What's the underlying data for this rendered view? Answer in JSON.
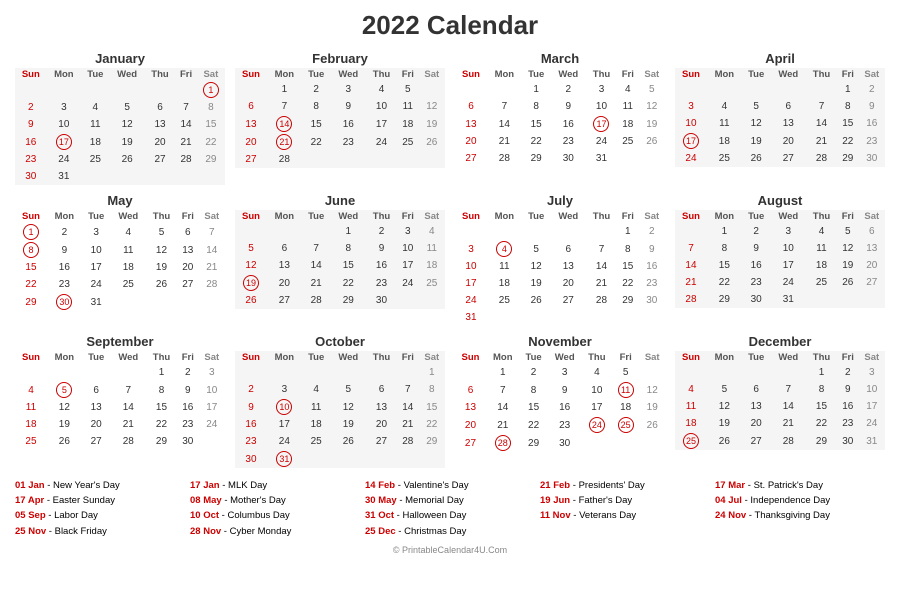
{
  "title": "2022 Calendar",
  "months": [
    {
      "name": "January",
      "days": [
        [
          "",
          "",
          "",
          "",
          "",
          "",
          "1"
        ],
        [
          "2",
          "3",
          "4",
          "5",
          "6",
          "7",
          "8"
        ],
        [
          "9",
          "10",
          "11",
          "12",
          "13",
          "14",
          "15"
        ],
        [
          "16",
          "17",
          "18",
          "19",
          "20",
          "21",
          "22"
        ],
        [
          "23",
          "24",
          "25",
          "26",
          "27",
          "28",
          "29"
        ],
        [
          "30",
          "31",
          "",
          "",
          "",
          "",
          ""
        ]
      ],
      "circles": [
        "1",
        "17"
      ],
      "gray": []
    },
    {
      "name": "February",
      "days": [
        [
          "",
          "1",
          "2",
          "3",
          "4",
          "5",
          ""
        ],
        [
          "6",
          "7",
          "8",
          "9",
          "10",
          "11",
          "12"
        ],
        [
          "13",
          "14",
          "15",
          "16",
          "17",
          "18",
          "19"
        ],
        [
          "20",
          "21",
          "22",
          "23",
          "24",
          "25",
          "26"
        ],
        [
          "27",
          "28",
          "",
          "",
          "",
          "",
          ""
        ]
      ],
      "circles": [
        "14",
        "21"
      ],
      "gray": []
    },
    {
      "name": "March",
      "days": [
        [
          "",
          "",
          "1",
          "2",
          "3",
          "4",
          "5"
        ],
        [
          "6",
          "7",
          "8",
          "9",
          "10",
          "11",
          "12"
        ],
        [
          "13",
          "14",
          "15",
          "16",
          "17",
          "18",
          "19"
        ],
        [
          "20",
          "21",
          "22",
          "23",
          "24",
          "25",
          "26"
        ],
        [
          "27",
          "28",
          "29",
          "30",
          "31",
          "",
          ""
        ]
      ],
      "circles": [
        "17"
      ],
      "gray": []
    },
    {
      "name": "April",
      "days": [
        [
          "",
          "",
          "",
          "",
          "",
          "1",
          "2"
        ],
        [
          "3",
          "4",
          "5",
          "6",
          "7",
          "8",
          "9"
        ],
        [
          "10",
          "11",
          "12",
          "13",
          "14",
          "15",
          "16"
        ],
        [
          "17",
          "18",
          "19",
          "20",
          "21",
          "22",
          "23"
        ],
        [
          "24",
          "25",
          "26",
          "27",
          "28",
          "29",
          "30"
        ]
      ],
      "circles": [
        "17"
      ],
      "gray": []
    },
    {
      "name": "May",
      "days": [
        [
          "1",
          "2",
          "3",
          "4",
          "5",
          "6",
          "7"
        ],
        [
          "8",
          "9",
          "10",
          "11",
          "12",
          "13",
          "14"
        ],
        [
          "15",
          "16",
          "17",
          "18",
          "19",
          "20",
          "21"
        ],
        [
          "22",
          "23",
          "24",
          "25",
          "26",
          "27",
          "28"
        ],
        [
          "29",
          "30",
          "31",
          "",
          "",
          "",
          ""
        ]
      ],
      "circles": [
        "1",
        "8",
        "30"
      ],
      "gray": []
    },
    {
      "name": "June",
      "days": [
        [
          "",
          "",
          "",
          "1",
          "2",
          "3",
          "4"
        ],
        [
          "5",
          "6",
          "7",
          "8",
          "9",
          "10",
          "11"
        ],
        [
          "12",
          "13",
          "14",
          "15",
          "16",
          "17",
          "18"
        ],
        [
          "19",
          "20",
          "21",
          "22",
          "23",
          "24",
          "25"
        ],
        [
          "26",
          "27",
          "28",
          "29",
          "30",
          "",
          ""
        ]
      ],
      "circles": [
        "19"
      ],
      "gray": []
    },
    {
      "name": "July",
      "days": [
        [
          "",
          "",
          "",
          "",
          "",
          "1",
          "2"
        ],
        [
          "3",
          "4",
          "5",
          "6",
          "7",
          "8",
          "9"
        ],
        [
          "10",
          "11",
          "12",
          "13",
          "14",
          "15",
          "16"
        ],
        [
          "17",
          "18",
          "19",
          "20",
          "21",
          "22",
          "23"
        ],
        [
          "24",
          "25",
          "26",
          "27",
          "28",
          "29",
          "30"
        ],
        [
          "31",
          "",
          "",
          "",
          "",
          "",
          ""
        ]
      ],
      "circles": [
        "4"
      ],
      "gray": []
    },
    {
      "name": "August",
      "days": [
        [
          "",
          "1",
          "2",
          "3",
          "4",
          "5",
          "6"
        ],
        [
          "7",
          "8",
          "9",
          "10",
          "11",
          "12",
          "13"
        ],
        [
          "14",
          "15",
          "16",
          "17",
          "18",
          "19",
          "20"
        ],
        [
          "21",
          "22",
          "23",
          "24",
          "25",
          "26",
          "27"
        ],
        [
          "28",
          "29",
          "30",
          "31",
          "",
          "",
          ""
        ]
      ],
      "circles": [],
      "gray": []
    },
    {
      "name": "September",
      "days": [
        [
          "",
          "",
          "",
          "",
          "1",
          "2",
          "3"
        ],
        [
          "4",
          "5",
          "6",
          "7",
          "8",
          "9",
          "10"
        ],
        [
          "11",
          "12",
          "13",
          "14",
          "15",
          "16",
          "17"
        ],
        [
          "18",
          "19",
          "20",
          "21",
          "22",
          "23",
          "24"
        ],
        [
          "25",
          "26",
          "27",
          "28",
          "29",
          "30",
          ""
        ]
      ],
      "circles": [
        "5"
      ],
      "gray": []
    },
    {
      "name": "October",
      "days": [
        [
          "",
          "",
          "",
          "",
          "",
          "",
          "1"
        ],
        [
          "2",
          "3",
          "4",
          "5",
          "6",
          "7",
          "8"
        ],
        [
          "9",
          "10",
          "11",
          "12",
          "13",
          "14",
          "15"
        ],
        [
          "16",
          "17",
          "18",
          "19",
          "20",
          "21",
          "22"
        ],
        [
          "23",
          "24",
          "25",
          "26",
          "27",
          "28",
          "29"
        ],
        [
          "30",
          "31",
          "",
          "",
          "",
          "",
          ""
        ]
      ],
      "circles": [
        "10",
        "31"
      ],
      "gray": []
    },
    {
      "name": "November",
      "days": [
        [
          "",
          "1",
          "2",
          "3",
          "4",
          "5",
          ""
        ],
        [
          "6",
          "7",
          "8",
          "9",
          "10",
          "11",
          "12"
        ],
        [
          "13",
          "14",
          "15",
          "16",
          "17",
          "18",
          "19"
        ],
        [
          "20",
          "21",
          "22",
          "23",
          "24",
          "25",
          "26"
        ],
        [
          "27",
          "28",
          "29",
          "30",
          "",
          "",
          ""
        ]
      ],
      "circles": [
        "11",
        "24",
        "25",
        "28"
      ],
      "gray": []
    },
    {
      "name": "December",
      "days": [
        [
          "",
          "",
          "",
          "",
          "1",
          "2",
          "3"
        ],
        [
          "4",
          "5",
          "6",
          "7",
          "8",
          "9",
          "10"
        ],
        [
          "11",
          "12",
          "13",
          "14",
          "15",
          "16",
          "17"
        ],
        [
          "18",
          "19",
          "20",
          "21",
          "22",
          "23",
          "24"
        ],
        [
          "25",
          "26",
          "27",
          "28",
          "29",
          "30",
          "31"
        ]
      ],
      "circles": [
        "25"
      ],
      "gray": []
    }
  ],
  "holidays": [
    {
      "date": "01 Jan",
      "name": "New Year's Day"
    },
    {
      "date": "17 Apr",
      "name": "Easter Sunday"
    },
    {
      "date": "05 Sep",
      "name": "Labor Day"
    },
    {
      "date": "25 Nov",
      "name": "Black Friday"
    },
    {
      "date": "17 Jan",
      "name": "MLK Day"
    },
    {
      "date": "08 May",
      "name": "Mother's Day"
    },
    {
      "date": "10 Oct",
      "name": "Columbus Day"
    },
    {
      "date": "28 Nov",
      "name": "Cyber Monday"
    },
    {
      "date": "14 Feb",
      "name": "Valentine's Day"
    },
    {
      "date": "30 May",
      "name": "Memorial Day"
    },
    {
      "date": "31 Oct",
      "name": "Halloween Day"
    },
    {
      "date": "25 Dec",
      "name": "Christmas Day"
    },
    {
      "date": "21 Feb",
      "name": "Presidents' Day"
    },
    {
      "date": "19 Jun",
      "name": "Father's Day"
    },
    {
      "date": "11 Nov",
      "name": "Veterans Day"
    },
    {
      "date": "17 Mar",
      "name": "St. Patrick's Day"
    },
    {
      "date": "04 Jul",
      "name": "Independence Day"
    },
    {
      "date": "24 Nov",
      "name": "Thanksgiving Day"
    }
  ],
  "footer": "© PrintableCalendar4U.Com"
}
